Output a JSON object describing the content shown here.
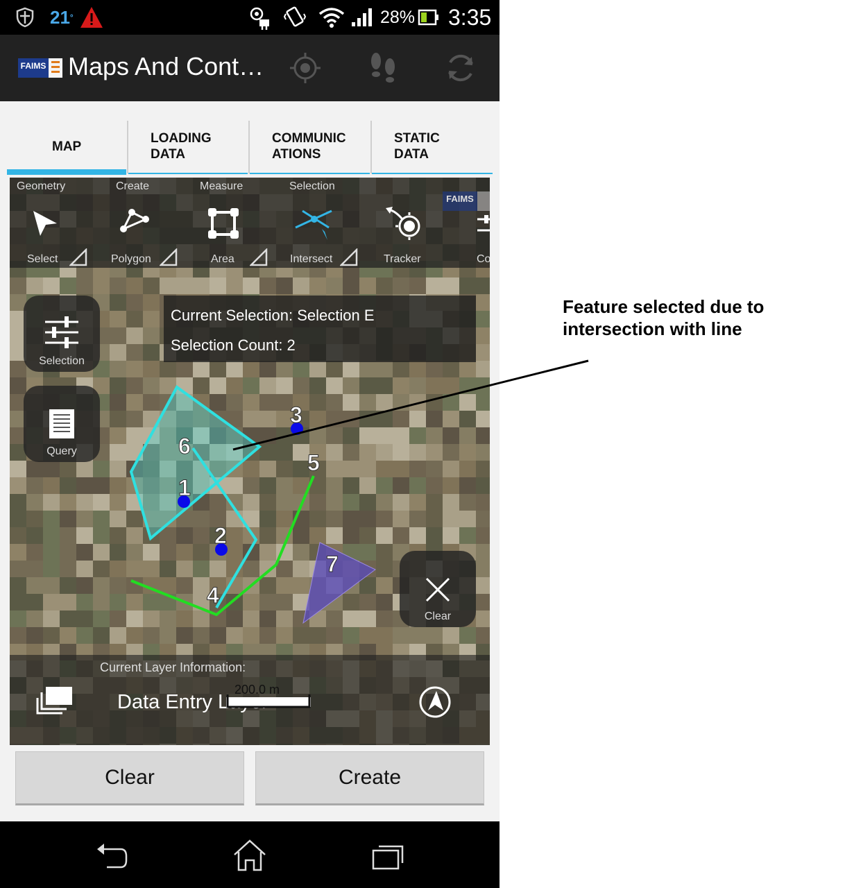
{
  "status_bar": {
    "temperature": "21",
    "battery": "28%",
    "time": "3:35"
  },
  "action_bar": {
    "logo_text": "FAIMS",
    "title": "Maps And Cont…",
    "icons": [
      "gps-target-icon",
      "footsteps-icon",
      "sync-icon"
    ]
  },
  "tabs": [
    {
      "line1": "MAP",
      "line2": "",
      "active": true
    },
    {
      "line1": "LOADING",
      "line2": "DATA",
      "active": false
    },
    {
      "line1": "COMMUNIC",
      "line2": "ATIONS",
      "active": false
    },
    {
      "line1": "STATIC",
      "line2": "DATA",
      "active": false
    }
  ],
  "toolbar": {
    "groups": [
      "Geometry",
      "Create",
      "Measure",
      "Selection"
    ],
    "tools": [
      "Select",
      "Polygon",
      "Area",
      "Intersect",
      "Tracker",
      "Co"
    ],
    "active_tool": "Intersect",
    "watermark": "FAIMS"
  },
  "map_buttons": {
    "selection": "Selection",
    "query": "Query",
    "clear": "Clear"
  },
  "selection_info": {
    "current_selection": "Current Selection: Selection E",
    "count": "Selection Count: 2"
  },
  "features": {
    "labels": [
      "1",
      "2",
      "3",
      "4",
      "5",
      "6",
      "7"
    ],
    "colors": {
      "selected": "#2fe0e0",
      "line": "#22dd22",
      "point": "#0a0ae8",
      "triangle": "#5a4ab8"
    }
  },
  "layer_bar": {
    "caption": "Current Layer Information:",
    "layer_name": "Data Entry Layer",
    "scale": "200.0 m"
  },
  "bottom_buttons": {
    "clear": "Clear",
    "create": "Create"
  },
  "annotation": {
    "line1": "Feature selected due to",
    "line2": "intersection with line"
  }
}
